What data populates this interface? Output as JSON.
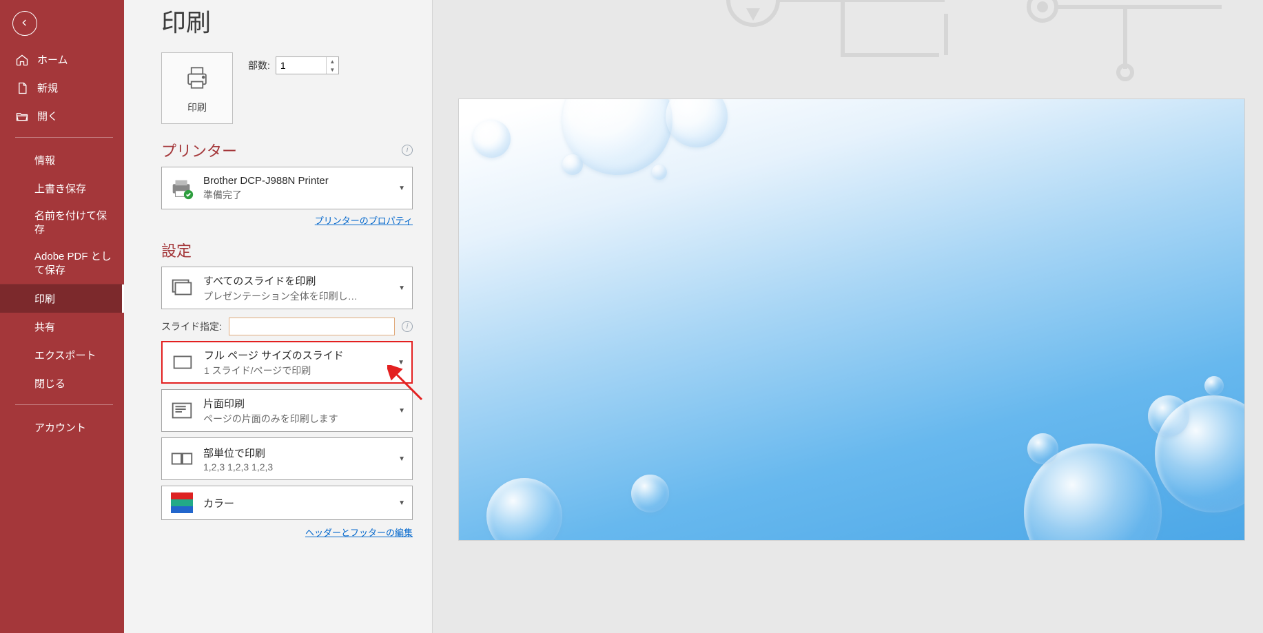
{
  "sidebar": {
    "items": [
      {
        "label": "ホーム",
        "icon": "home-icon"
      },
      {
        "label": "新規",
        "icon": "new-icon"
      },
      {
        "label": "開く",
        "icon": "open-icon"
      }
    ],
    "items2": [
      {
        "label": "情報"
      },
      {
        "label": "上書き保存"
      },
      {
        "label": "名前を付けて保存"
      },
      {
        "label": "Adobe PDF として保存"
      },
      {
        "label": "印刷",
        "active": true
      },
      {
        "label": "共有"
      },
      {
        "label": "エクスポート"
      },
      {
        "label": "閉じる"
      }
    ],
    "items3": [
      {
        "label": "アカウント"
      }
    ]
  },
  "page": {
    "title": "印刷"
  },
  "print": {
    "button_label": "印刷",
    "copies_label": "部数:",
    "copies_value": "1"
  },
  "printer_section": {
    "title": "プリンター",
    "name": "Brother DCP-J988N Printer",
    "status": "準備完了",
    "properties_link": "プリンターのプロパティ"
  },
  "settings_section": {
    "title": "設定",
    "range": {
      "t1": "すべてのスライドを印刷",
      "t2": "プレゼンテーション全体を印刷し…"
    },
    "slides_field_label": "スライド指定:",
    "layout": {
      "t1": "フル ページ サイズのスライド",
      "t2": "1 スライド/ページで印刷"
    },
    "sides": {
      "t1": "片面印刷",
      "t2": "ページの片面のみを印刷します"
    },
    "collate": {
      "t1": "部単位で印刷",
      "t2": "1,2,3    1,2,3    1,2,3"
    },
    "color": {
      "t1": "カラー"
    },
    "footer_link": "ヘッダーとフッターの編集"
  }
}
